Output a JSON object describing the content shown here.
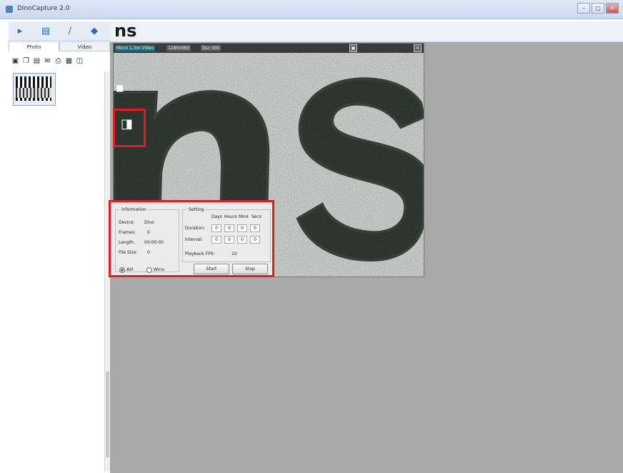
{
  "window": {
    "title": "DinoCapture 2.0",
    "btn_min": "–",
    "btn_max": "□",
    "btn_close": "✕"
  },
  "main": {
    "logo": "ns"
  },
  "sidebar": {
    "tabs": [
      {
        "label": "Photo"
      },
      {
        "label": "Video"
      }
    ],
    "tools": [
      {
        "icon": "camera-icon"
      },
      {
        "icon": "list-icon"
      },
      {
        "icon": "pen-icon"
      },
      {
        "icon": "shield-icon"
      }
    ],
    "thumb_tools": [
      {
        "icon": "save-icon"
      },
      {
        "icon": "copy-icon"
      },
      {
        "icon": "page-icon"
      },
      {
        "icon": "email-icon"
      },
      {
        "icon": "print-icon"
      },
      {
        "icon": "image-icon"
      },
      {
        "icon": "trash-icon"
      }
    ]
  },
  "preview": {
    "header_items": [
      "Micro 1.3m Video",
      "1280x960",
      "Dsc 000"
    ]
  },
  "info_panel": {
    "info_title": "Information",
    "device_label": "Device:",
    "device_value": "Dino",
    "frames_label": "Frames:",
    "frames_value": "0",
    "length_label": "Length:",
    "length_value": "00:00:00",
    "filesize_label": "File Size:",
    "filesize_value": "0",
    "avi_label": "AVI",
    "wmv_label": "Wmv",
    "setting_title": "Setting",
    "col_headers": [
      "Days",
      "Hours",
      "Mins",
      "Secs"
    ],
    "duration_label": "Duration:",
    "duration_values": [
      "0",
      "0",
      "0",
      "0"
    ],
    "interval_label": "Interval:",
    "interval_values": [
      "0",
      "0",
      "0",
      "0"
    ],
    "playback_label": "Playback FPS:",
    "playback_value": "10",
    "start_label": "Start",
    "stop_label": "Stop"
  },
  "colors": {
    "highlight": "#e31b23",
    "workspace": "#a9a9a9",
    "titlebar": "#dfe9f5"
  }
}
